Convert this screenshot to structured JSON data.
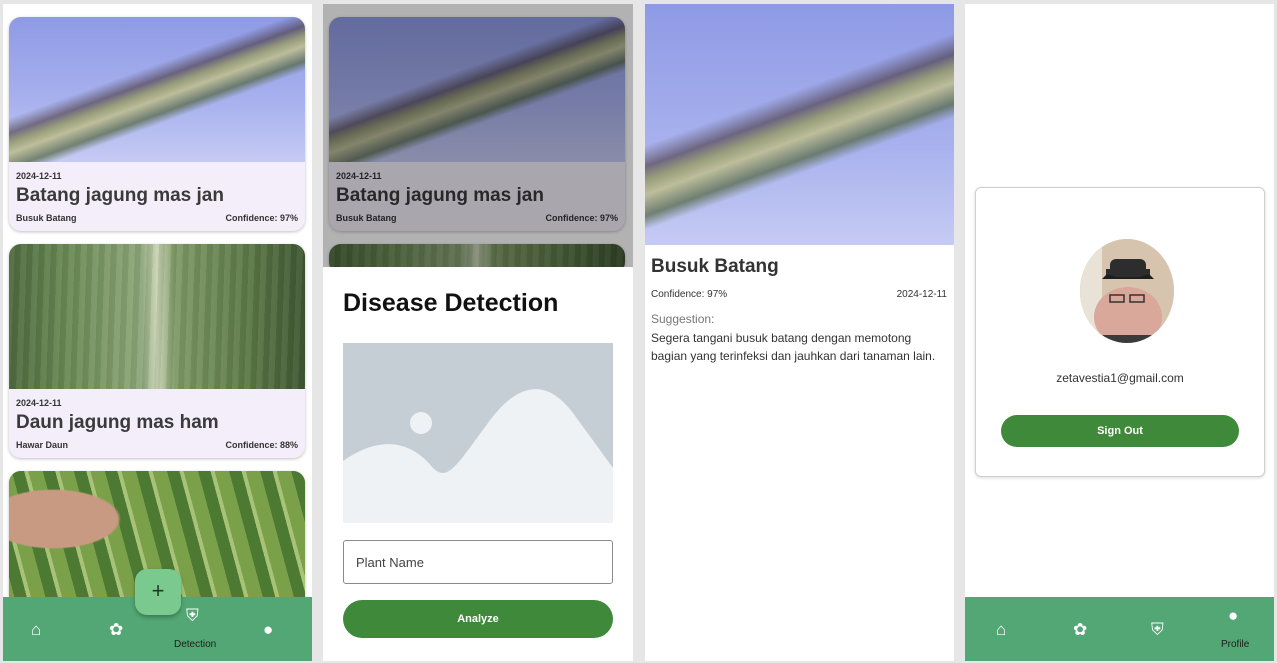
{
  "feed": {
    "cards": [
      {
        "date": "2024-12-11",
        "title": "Batang jagung mas jan",
        "disease": "Busuk Batang",
        "confidence": "Confidence: 97%"
      },
      {
        "date": "2024-12-11",
        "title": "Daun jagung mas ham",
        "disease": "Hawar Daun",
        "confidence": "Confidence: 88%"
      }
    ],
    "fab_label": "+"
  },
  "nav_feed": {
    "home_icon": "⌂",
    "scan_icon": "✿",
    "detection_icon": "⛨",
    "detection_label": "Detection",
    "profile_icon": "●"
  },
  "detection_sheet": {
    "behind_card": {
      "date": "2024-12-11",
      "title": "Batang jagung mas jan",
      "disease": "Busuk Batang",
      "confidence": "Confidence: 97%"
    },
    "title": "Disease Detection",
    "plant_name_placeholder": "Plant Name",
    "analyze_label": "Analyze"
  },
  "detail": {
    "title": "Busuk Batang",
    "confidence": "Confidence: 97%",
    "date": "2024-12-11",
    "suggestion_label": "Suggestion:",
    "suggestion_text": "Segera tangani busuk batang dengan memotong bagian yang terinfeksi dan jauhkan dari tanaman lain."
  },
  "profile": {
    "email": "zetavestia1@gmail.com",
    "sign_out_label": "Sign Out"
  },
  "nav_profile": {
    "profile_label": "Profile"
  },
  "colors": {
    "nav": "#52a774",
    "button": "#3f8a3a",
    "card": "#f4eefa"
  }
}
